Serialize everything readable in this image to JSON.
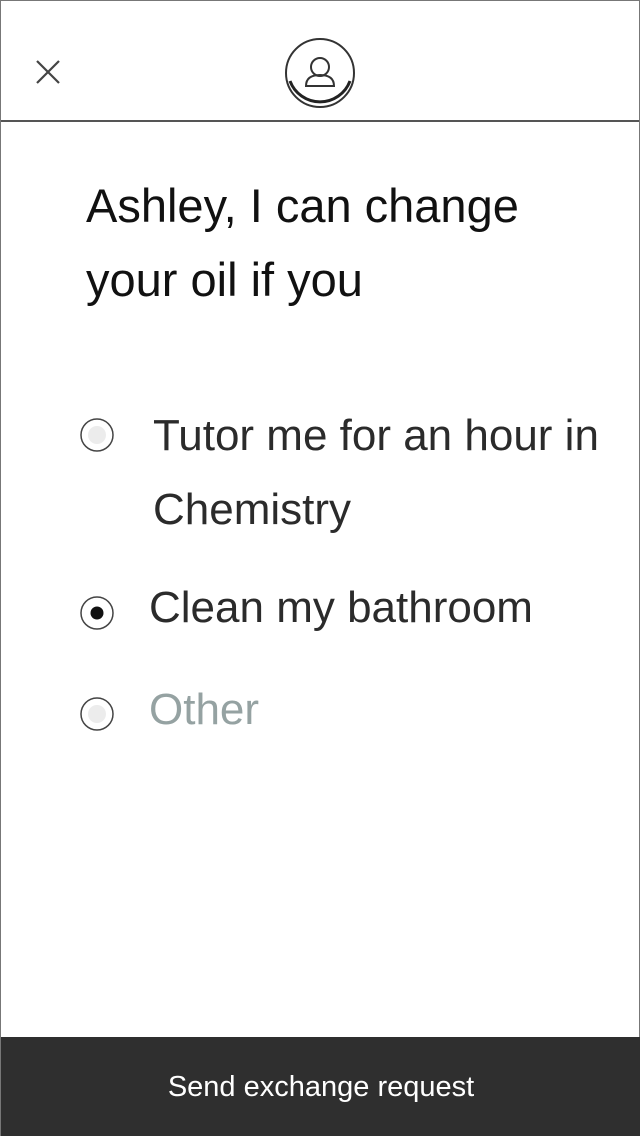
{
  "header": {
    "close_icon": "close-icon",
    "avatar_icon": "user-avatar-icon"
  },
  "main": {
    "title": "Ashley, I can change your oil if you",
    "options": [
      {
        "label": "Tutor me for an hour in Chemistry",
        "selected": false,
        "placeholder": false
      },
      {
        "label": "Clean my bathroom",
        "selected": true,
        "placeholder": false
      },
      {
        "label": "Other",
        "selected": false,
        "placeholder": true
      }
    ]
  },
  "footer": {
    "button_label": "Send exchange request"
  },
  "colors": {
    "footer_bg": "#2f2f2f",
    "placeholder_text": "#95a2a2"
  }
}
